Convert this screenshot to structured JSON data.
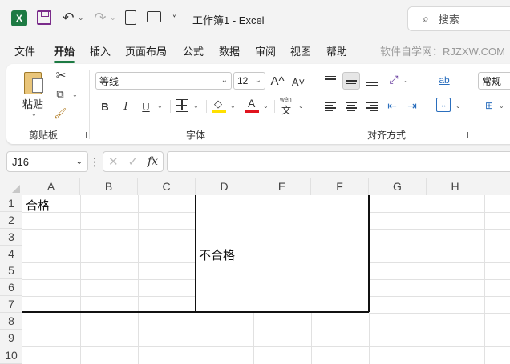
{
  "titlebar": {
    "app_icon": "X",
    "file_title": "工作簿1  -  Excel",
    "search_placeholder": "搜索",
    "customize_glyph": "⩡"
  },
  "menu": {
    "tabs": [
      "文件",
      "开始",
      "插入",
      "页面布局",
      "公式",
      "数据",
      "审阅",
      "视图",
      "帮助"
    ],
    "active_tab": "开始",
    "watermark": "软件自学网：RJZXW.COM"
  },
  "ribbon": {
    "clipboard": {
      "paste_label": "粘贴",
      "group_label": "剪贴板"
    },
    "font": {
      "font_name": "等线",
      "font_size": "12",
      "grow_label": "A^",
      "shrink_label": "A˅",
      "bold": "B",
      "italic": "I",
      "underline": "U",
      "font_color_letter": "A",
      "phonetic_top": "wén",
      "phonetic_bottom": "文",
      "group_label": "字体",
      "highlight_color": "#ffe000",
      "font_color": "#e0141e"
    },
    "alignment": {
      "group_label": "对齐方式",
      "wrap_label": "ab"
    },
    "number": {
      "format_value": "常规"
    }
  },
  "formula_bar": {
    "name_box": "J16",
    "fx_label": "fx",
    "formula_value": ""
  },
  "sheet": {
    "columns": [
      "A",
      "B",
      "C",
      "D",
      "E",
      "F",
      "G",
      "H"
    ],
    "rows": [
      "1",
      "2",
      "3",
      "4",
      "5",
      "6",
      "7",
      "8",
      "9",
      "10"
    ],
    "cells": {
      "A1": "合格",
      "D4": "不合格"
    }
  }
}
